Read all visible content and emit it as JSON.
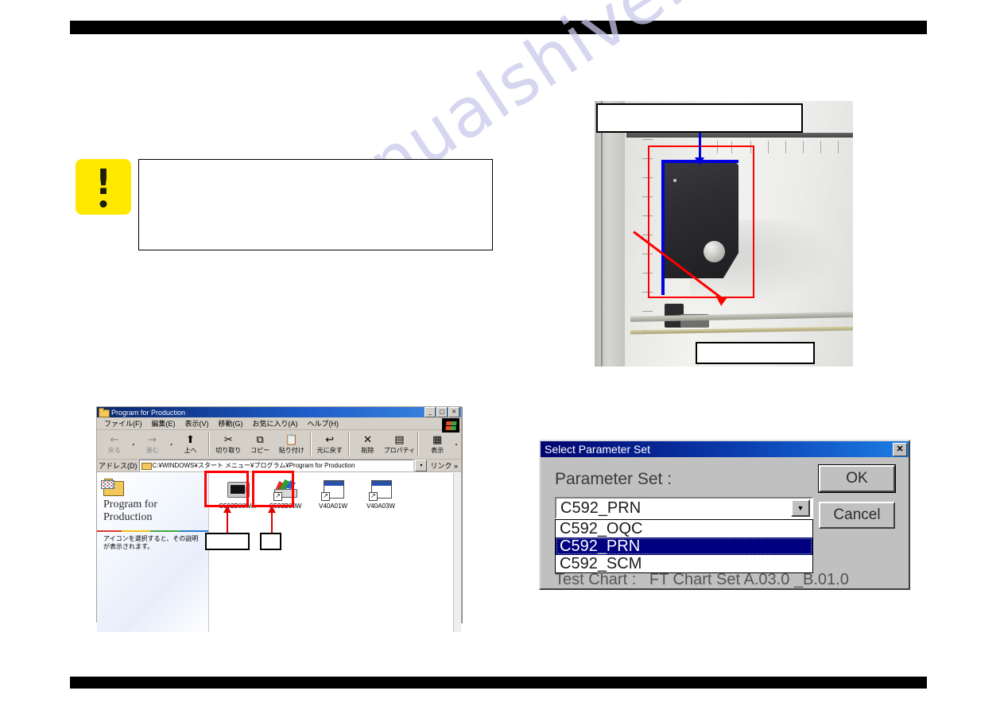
{
  "page": {
    "watermark": "manualshive.com",
    "header_bar": "",
    "footer_bar": ""
  },
  "caution": {
    "icon": "exclamation-icon",
    "text": ""
  },
  "photo": {
    "alt_name": "printer-carriage-photo",
    "callout_top_text": "",
    "callout_bottom_text": "",
    "annotation_colors": {
      "box_red": "#ff0000",
      "bracket_blue": "#0000e0"
    }
  },
  "explorer": {
    "title": "Program for Production",
    "window_buttons": {
      "minimize": "_",
      "maximize": "□",
      "close": "✕"
    },
    "menu": [
      "ファイル(F)",
      "編集(E)",
      "表示(V)",
      "移動(G)",
      "お気に入り(A)",
      "ヘルプ(H)"
    ],
    "toolbar": [
      {
        "label": "戻る",
        "glyph": "←",
        "dim": true
      },
      {
        "label": "進む",
        "glyph": "→",
        "dim": true
      },
      {
        "label": "上へ",
        "glyph": "⬆",
        "dim": false
      },
      {
        "label": "切り取り",
        "glyph": "✂",
        "dim": false
      },
      {
        "label": "コピー",
        "glyph": "⧉",
        "dim": false
      },
      {
        "label": "貼り付け",
        "glyph": "📋",
        "dim": false
      },
      {
        "label": "元に戻す",
        "glyph": "↩",
        "dim": false
      },
      {
        "label": "削除",
        "glyph": "✕",
        "dim": false
      },
      {
        "label": "プロパティ",
        "glyph": "▤",
        "dim": false
      },
      {
        "label": "表示",
        "glyph": "▦",
        "dim": false
      }
    ],
    "address": {
      "label": "アドレス(D)",
      "value": "C:¥WINDOWS¥スタート メニュー¥プログラム¥Program for Production",
      "links_label": "リンク »"
    },
    "info_panel": {
      "title_line1": "Program for",
      "title_line2": "Production",
      "description": "アイコンを選択すると、その説明が表示されます。"
    },
    "files": [
      {
        "name": "C592B00We.",
        "icon": "monitor-icon"
      },
      {
        "name": "C592B00W",
        "icon": "color-chart-icon"
      },
      {
        "name": "V40A01W",
        "icon": "window-shortcut-icon"
      },
      {
        "name": "V40A03W",
        "icon": "window-shortcut-icon"
      }
    ],
    "callouts": [
      {
        "text": ""
      },
      {
        "text": ""
      }
    ]
  },
  "dialog": {
    "title": "Select Parameter Set",
    "close_label": "✕",
    "parameter_set_label": "Parameter Set :",
    "selected_value": "C592_PRN",
    "options": [
      {
        "label": "C592_OQC",
        "selected": false
      },
      {
        "label": "C592_PRN",
        "selected": true
      },
      {
        "label": "C592_SCM",
        "selected": false
      }
    ],
    "test_chart": "Test Chart :   FT Chart Set A.03.0 _B.01.0",
    "ok_label": "OK",
    "cancel_label": "Cancel"
  }
}
